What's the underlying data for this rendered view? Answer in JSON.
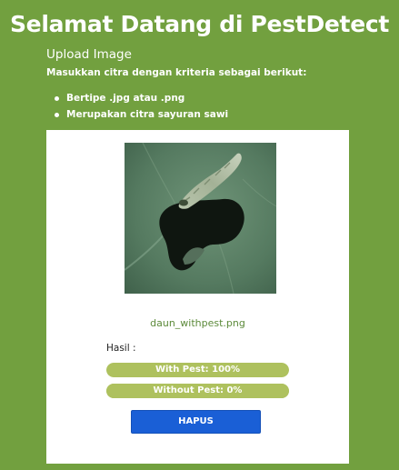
{
  "header": {
    "title": "Selamat Datang di PestDetect",
    "subtitle": "Upload Image",
    "intro": "Masukkan citra dengan kriteria sebagai berikut:",
    "criteria": [
      "Bertipe .jpg atau .png",
      "Merupakan citra sayuran sawi"
    ]
  },
  "upload": {
    "image_icon": "leaf-with-caterpillar-photo",
    "filename": "daun_withpest.png"
  },
  "result": {
    "label": "Hasil :",
    "with_pest": {
      "text": "With Pest: 100%",
      "value": 1.0
    },
    "without_pest": {
      "text": "Without Pest: 0%",
      "value": 0.0
    }
  },
  "actions": {
    "delete_label": "HAPUS"
  },
  "colors": {
    "background": "#72a03f",
    "progress": "#aec15e",
    "button": "#1a5fd6",
    "filename": "#5c8a3a"
  }
}
